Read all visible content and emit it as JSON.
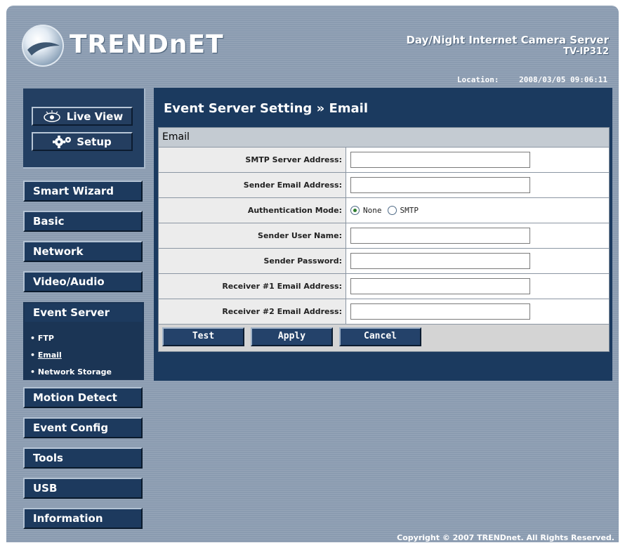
{
  "header": {
    "logo_text": "TRENDnET",
    "product_title": "Day/Night Internet Camera Server",
    "model": "TV-IP312",
    "location_label": "Location:",
    "location_value": "2008/03/05 09:06:11"
  },
  "sidebar": {
    "live_view": "Live View",
    "setup": "Setup",
    "items": [
      {
        "label": "Smart Wizard"
      },
      {
        "label": "Basic"
      },
      {
        "label": "Network"
      },
      {
        "label": "Video/Audio"
      },
      {
        "label": "Event Server"
      },
      {
        "label": "Motion Detect"
      },
      {
        "label": "Event Config"
      },
      {
        "label": "Tools"
      },
      {
        "label": "USB"
      },
      {
        "label": "Information"
      }
    ],
    "sub_items": [
      {
        "label": "FTP",
        "active": false
      },
      {
        "label": "Email",
        "active": true
      },
      {
        "label": "Network Storage",
        "active": false
      }
    ],
    "bullet": "•"
  },
  "main": {
    "title": "Event Server Setting » Email",
    "section_title": "Email",
    "fields": {
      "smtp_server": {
        "label": "SMTP Server Address:",
        "value": ""
      },
      "sender_email": {
        "label": "Sender Email Address:",
        "value": ""
      },
      "auth_mode": {
        "label": "Authentication Mode:",
        "options": [
          "None",
          "SMTP"
        ],
        "selected": "None"
      },
      "sender_user": {
        "label": "Sender User Name:",
        "value": ""
      },
      "sender_password": {
        "label": "Sender Password:",
        "value": ""
      },
      "receiver1": {
        "label": "Receiver #1 Email Address:",
        "value": ""
      },
      "receiver2": {
        "label": "Receiver #2 Email Address:",
        "value": ""
      }
    },
    "buttons": {
      "test": "Test",
      "apply": "Apply",
      "cancel": "Cancel"
    }
  },
  "footer": {
    "copyright": "Copyright © 2007 TRENDnet. All Rights Reserved."
  },
  "colors": {
    "navy": "#1b3a5f",
    "frame": "#8a9bb0",
    "panel": "#f2f2f2",
    "radio_checked": "#2e7d2e"
  }
}
